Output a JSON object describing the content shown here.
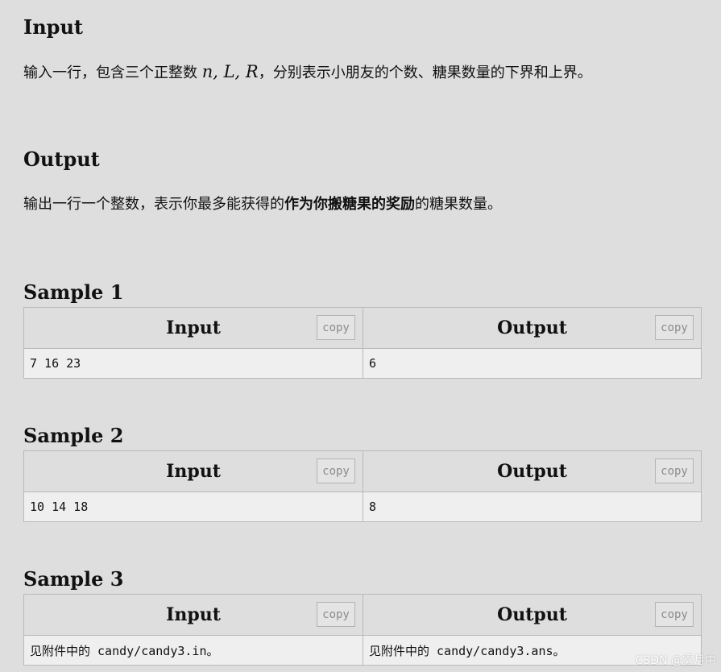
{
  "input_section": {
    "title": "Input",
    "text_before": "输入一行，包含三个正整数 ",
    "math": "n, L, R",
    "text_after": "，分别表示小朋友的个数、糖果数量的下界和上界。"
  },
  "output_section": {
    "title": "Output",
    "text_before": "输出一行一个整数，表示你最多能获得的",
    "bold_text": "作为你搬糖果的奖励",
    "text_after": "的糖果数量。"
  },
  "samples": [
    {
      "title": "Sample 1",
      "input_header": "Input",
      "output_header": "Output",
      "copy_label": "copy",
      "input_value": "7 16 23",
      "output_value": "6"
    },
    {
      "title": "Sample 2",
      "input_header": "Input",
      "output_header": "Output",
      "copy_label": "copy",
      "input_value": "10 14 18",
      "output_value": "8"
    },
    {
      "title": "Sample 3",
      "input_header": "Input",
      "output_header": "Output",
      "copy_label": "copy",
      "input_value": "见附件中的 candy/candy3.in。",
      "output_value": "见附件中的 candy/candy3.ans。"
    }
  ],
  "watermark": "CSDN @雾月中"
}
